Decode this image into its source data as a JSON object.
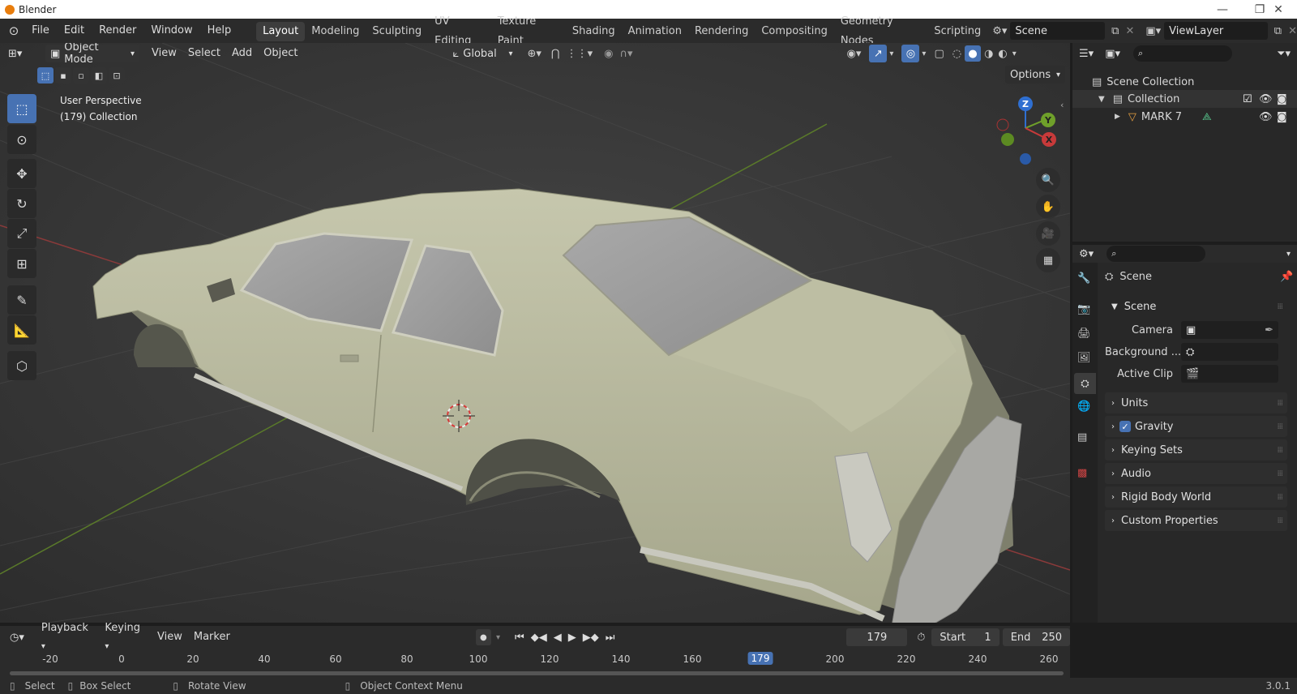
{
  "window": {
    "title": "Blender"
  },
  "menu": [
    "File",
    "Edit",
    "Render",
    "Window",
    "Help"
  ],
  "workspaces": [
    "Layout",
    "Modeling",
    "Sculpting",
    "UV Editing",
    "Texture Paint",
    "Shading",
    "Animation",
    "Rendering",
    "Compositing",
    "Geometry Nodes",
    "Scripting"
  ],
  "active_workspace": "Layout",
  "scene_field": "Scene",
  "viewlayer_field": "ViewLayer",
  "viewport_header": {
    "mode": "Object Mode",
    "menus": [
      "View",
      "Select",
      "Add",
      "Object"
    ],
    "orientation": "Global",
    "options": "Options"
  },
  "viewport_overlay": {
    "line1": "User Perspective",
    "line2": "(179) Collection"
  },
  "gizmo": {
    "z": "Z",
    "y": "Y",
    "x": "X"
  },
  "outliner": {
    "scene_collection": "Scene Collection",
    "collection": "Collection",
    "object": "MARK 7"
  },
  "properties": {
    "header": "Scene",
    "panel": "Scene",
    "camera_label": "Camera",
    "background_label": "Background ...",
    "active_clip_label": "Active Clip",
    "sections": [
      "Units",
      "Gravity",
      "Keying Sets",
      "Audio",
      "Rigid Body World",
      "Custom Properties"
    ],
    "gravity_checked": true
  },
  "timeline": {
    "menus": [
      "Playback",
      "Keying",
      "View",
      "Marker"
    ],
    "current_frame": "179",
    "start_label": "Start",
    "start_value": "1",
    "end_label": "End",
    "end_value": "250",
    "ticks": [
      "-20",
      "0",
      "20",
      "40",
      "60",
      "80",
      "100",
      "120",
      "140",
      "160",
      "179",
      "200",
      "220",
      "240",
      "260"
    ]
  },
  "statusbar": {
    "select": "Select",
    "box_select": "Box Select",
    "rotate": "Rotate View",
    "context": "Object Context Menu",
    "version": "3.0.1"
  },
  "colors": {
    "accent": "#4772b3",
    "car": "#b7b89c",
    "grid_x": "#8a3a3a",
    "grid_y": "#5a7a2a"
  }
}
